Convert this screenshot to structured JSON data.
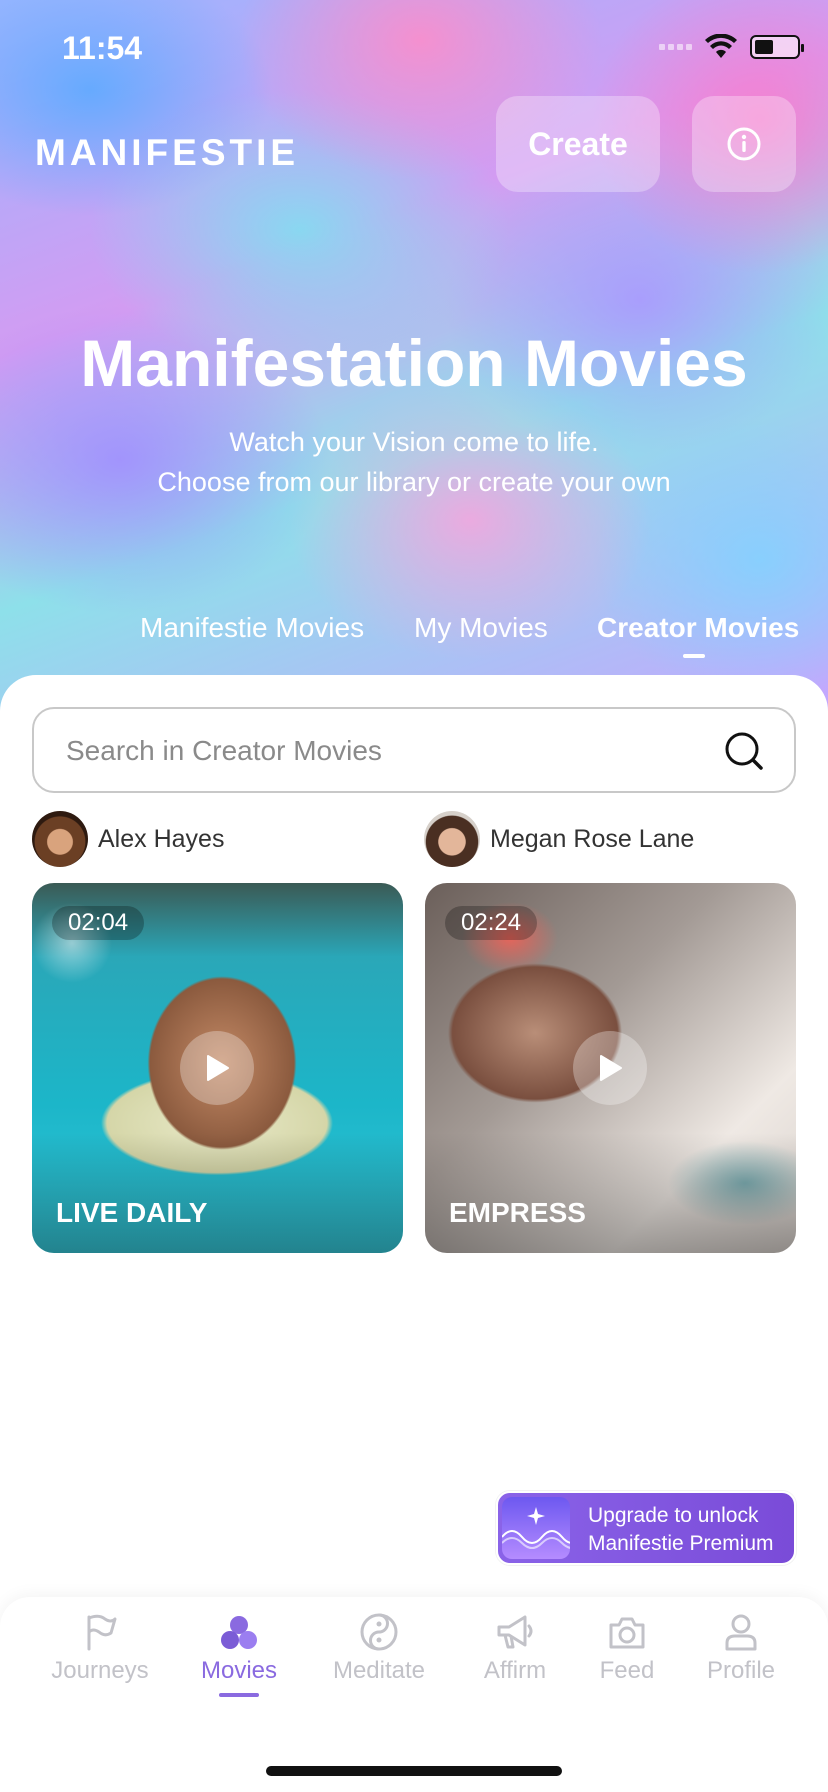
{
  "status_bar": {
    "time": "11:54"
  },
  "header": {
    "logo": "MANIFESTIE",
    "create_label": "Create"
  },
  "hero": {
    "title": "Manifestation Movies",
    "subtitle_line1": "Watch your Vision come to life.",
    "subtitle_line2": "Choose from our library or create your own"
  },
  "tabs": [
    {
      "label": "Manifestie Movies",
      "active": false
    },
    {
      "label": "My Movies",
      "active": false
    },
    {
      "label": "Creator Movies",
      "active": true
    }
  ],
  "search": {
    "placeholder": "Search in Creator Movies"
  },
  "movies": [
    {
      "creator": "Alex Hayes",
      "duration": "02:04",
      "title": "LIVE DAILY"
    },
    {
      "creator": "Megan Rose Lane",
      "duration": "02:24",
      "title": "EMPRESS"
    }
  ],
  "upgrade": {
    "line1": "Upgrade to unlock",
    "line2": "Manifestie Premium"
  },
  "nav": [
    {
      "label": "Journeys",
      "icon": "flag-icon",
      "active": false
    },
    {
      "label": "Movies",
      "icon": "movies-icon",
      "active": true
    },
    {
      "label": "Meditate",
      "icon": "yin-yang-icon",
      "active": false
    },
    {
      "label": "Affirm",
      "icon": "megaphone-icon",
      "active": false
    },
    {
      "label": "Feed",
      "icon": "camera-icon",
      "active": false
    },
    {
      "label": "Profile",
      "icon": "profile-icon",
      "active": false
    }
  ],
  "colors": {
    "accent": "#8a6ae0",
    "nav_inactive": "#c2c2c8",
    "upgrade_bg": "#7a4bd8"
  }
}
